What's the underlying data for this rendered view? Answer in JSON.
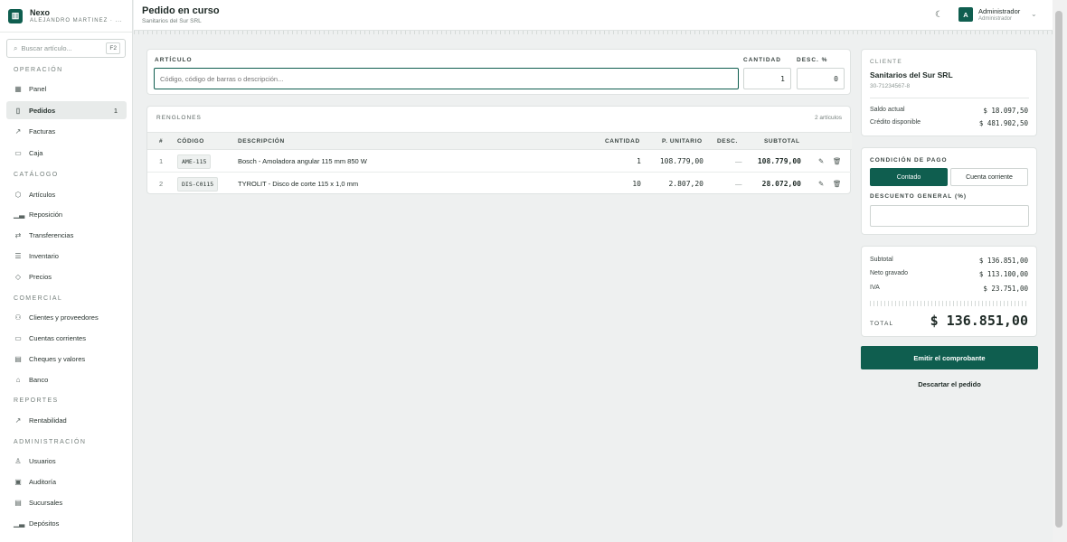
{
  "brand": {
    "name": "Nexo",
    "user": "ALEJANDRO MARTINEZ · ..."
  },
  "search": {
    "placeholder": "Buscar artículo...",
    "shortcut": "F2"
  },
  "sidebar": {
    "sections": [
      {
        "title": "OPERACIÓN",
        "items": [
          {
            "label": "Panel",
            "icon": "grid-icon"
          },
          {
            "label": "Pedidos",
            "icon": "document-icon",
            "count": "1",
            "active": true
          },
          {
            "label": "Facturas",
            "icon": "chart-line-icon"
          },
          {
            "label": "Caja",
            "icon": "register-icon"
          }
        ]
      },
      {
        "title": "CATÁLOGO",
        "items": [
          {
            "label": "Artículos",
            "icon": "box-icon"
          },
          {
            "label": "Reposición",
            "icon": "bars-icon"
          },
          {
            "label": "Transferencias",
            "icon": "arrows-icon"
          },
          {
            "label": "Inventario",
            "icon": "list-icon"
          },
          {
            "label": "Precios",
            "icon": "tag-icon"
          }
        ]
      },
      {
        "title": "COMERCIAL",
        "items": [
          {
            "label": "Clientes y proveedores",
            "icon": "users-icon"
          },
          {
            "label": "Cuentas corrientes",
            "icon": "card-icon"
          },
          {
            "label": "Cheques y valores",
            "icon": "check-icon"
          },
          {
            "label": "Banco",
            "icon": "bank-icon"
          }
        ]
      },
      {
        "title": "REPORTES",
        "items": [
          {
            "label": "Rentabilidad",
            "icon": "trend-icon"
          }
        ]
      },
      {
        "title": "ADMINISTRACIÓN",
        "items": [
          {
            "label": "Usuarios",
            "icon": "user-icon"
          },
          {
            "label": "Auditoría",
            "icon": "audit-icon"
          },
          {
            "label": "Sucursales",
            "icon": "store-icon"
          },
          {
            "label": "Depósitos",
            "icon": "warehouse-icon"
          }
        ]
      }
    ]
  },
  "header": {
    "title": "Pedido en curso",
    "subtitle": "Sanitarios del Sur SRL",
    "admin_initial": "A",
    "admin_name": "Administrador",
    "admin_role": "Administrador"
  },
  "entry": {
    "article_label": "ARTÍCULO",
    "article_placeholder": "Código, código de barras o descripción...",
    "qty_label": "CANTIDAD",
    "qty_value": "1",
    "disc_label": "DESC. %",
    "disc_value": "0"
  },
  "lines": {
    "title": "RENGLONES",
    "count_text": "2 artículos",
    "headers": [
      "#",
      "CÓDIGO",
      "DESCRIPCIÓN",
      "CANTIDAD",
      "P. UNITARIO",
      "DESC.",
      "SUBTOTAL"
    ],
    "rows": [
      {
        "n": "1",
        "code": "AME-115",
        "desc": "Bosch - Amoladora angular 115 mm 850 W",
        "qty": "1",
        "unit": "108.779,00",
        "disc": "—",
        "subtotal": "108.779,00"
      },
      {
        "n": "2",
        "code": "DIS-C0115",
        "desc": "TYROLIT - Disco de corte 115 x 1,0 mm",
        "qty": "10",
        "unit": "2.807,20",
        "disc": "—",
        "subtotal": "28.072,00"
      }
    ]
  },
  "client": {
    "label": "CLIENTE",
    "name": "Sanitarios del Sur SRL",
    "cuit": "30-71234567-8",
    "balance_label": "Saldo actual",
    "balance_value": "$ 18.097,50",
    "credit_label": "Crédito disponible",
    "credit_value": "$ 481.902,50"
  },
  "payment": {
    "label": "CONDICIÓN DE PAGO",
    "option_cash": "Contado",
    "option_account": "Cuenta corriente",
    "discount_label": "DESCUENTO GENERAL (%)",
    "discount_value": ""
  },
  "totals": {
    "subtotal_label": "Subtotal",
    "subtotal_value": "$ 136.851,00",
    "net_label": "Neto gravado",
    "net_value": "$ 113.100,00",
    "iva_label": "IVA",
    "iva_value": "$ 23.751,00",
    "total_label": "TOTAL",
    "total_value": "$ 136.851,00"
  },
  "actions": {
    "emit": "Emitir el comprobante",
    "discard": "Descartar el pedido"
  },
  "colors": {
    "primary": "#0f5e4f",
    "background": "#eef0f0"
  }
}
